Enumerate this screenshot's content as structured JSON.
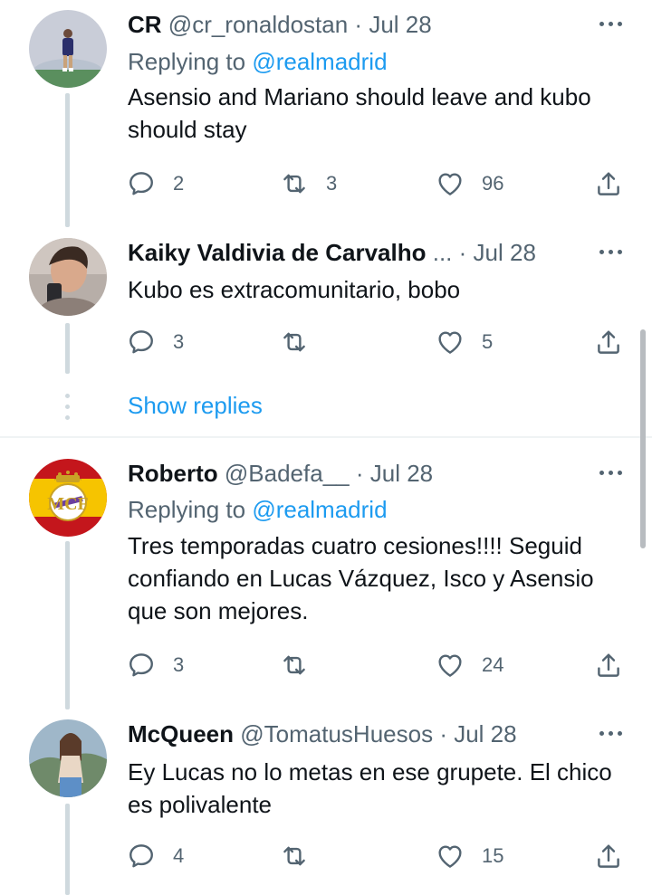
{
  "tweets": [
    {
      "name": "CR",
      "handle": "@cr_ronaldostan",
      "separator": "·",
      "date": "Jul 28",
      "reply_prefix": "Replying to",
      "reply_handle": "@realmadrid",
      "text": "Asensio and Mariano should leave and kubo should stay",
      "replies": "2",
      "retweets": "3",
      "likes": "96"
    },
    {
      "name": "Kaiky Valdivia de Carvalho",
      "handle": "...",
      "separator": "·",
      "date": "Jul 28",
      "text": "Kubo es extracomunitario, bobo",
      "replies": "3",
      "retweets": "",
      "likes": "5"
    },
    {
      "name": "Roberto",
      "handle": "@Badefa__",
      "separator": "·",
      "date": "Jul 28",
      "reply_prefix": "Replying to",
      "reply_handle": "@realmadrid",
      "text": "Tres temporadas cuatro cesiones!!!! Seguid confiando en Lucas Vázquez, Isco y Asensio que son mejores.",
      "replies": "3",
      "retweets": "",
      "likes": "24"
    },
    {
      "name": "McQueen",
      "handle": "@TomatusHuesos",
      "separator": "·",
      "date": "Jul 28",
      "text": "Ey Lucas no lo metas en ese grupete.  El chico es polivalente",
      "replies": "4",
      "retweets": "",
      "likes": "15"
    }
  ],
  "show_replies_label": "Show replies",
  "icons": {
    "reply": "speech-bubble-icon",
    "retweet": "retweet-arrows-icon",
    "like": "heart-icon",
    "share": "share-upload-icon",
    "more": "more-horizontal-icon"
  },
  "colors": {
    "link": "#1d9bf0",
    "secondary": "#536471",
    "text": "#0f1419",
    "thread_line": "#cfd9de"
  }
}
